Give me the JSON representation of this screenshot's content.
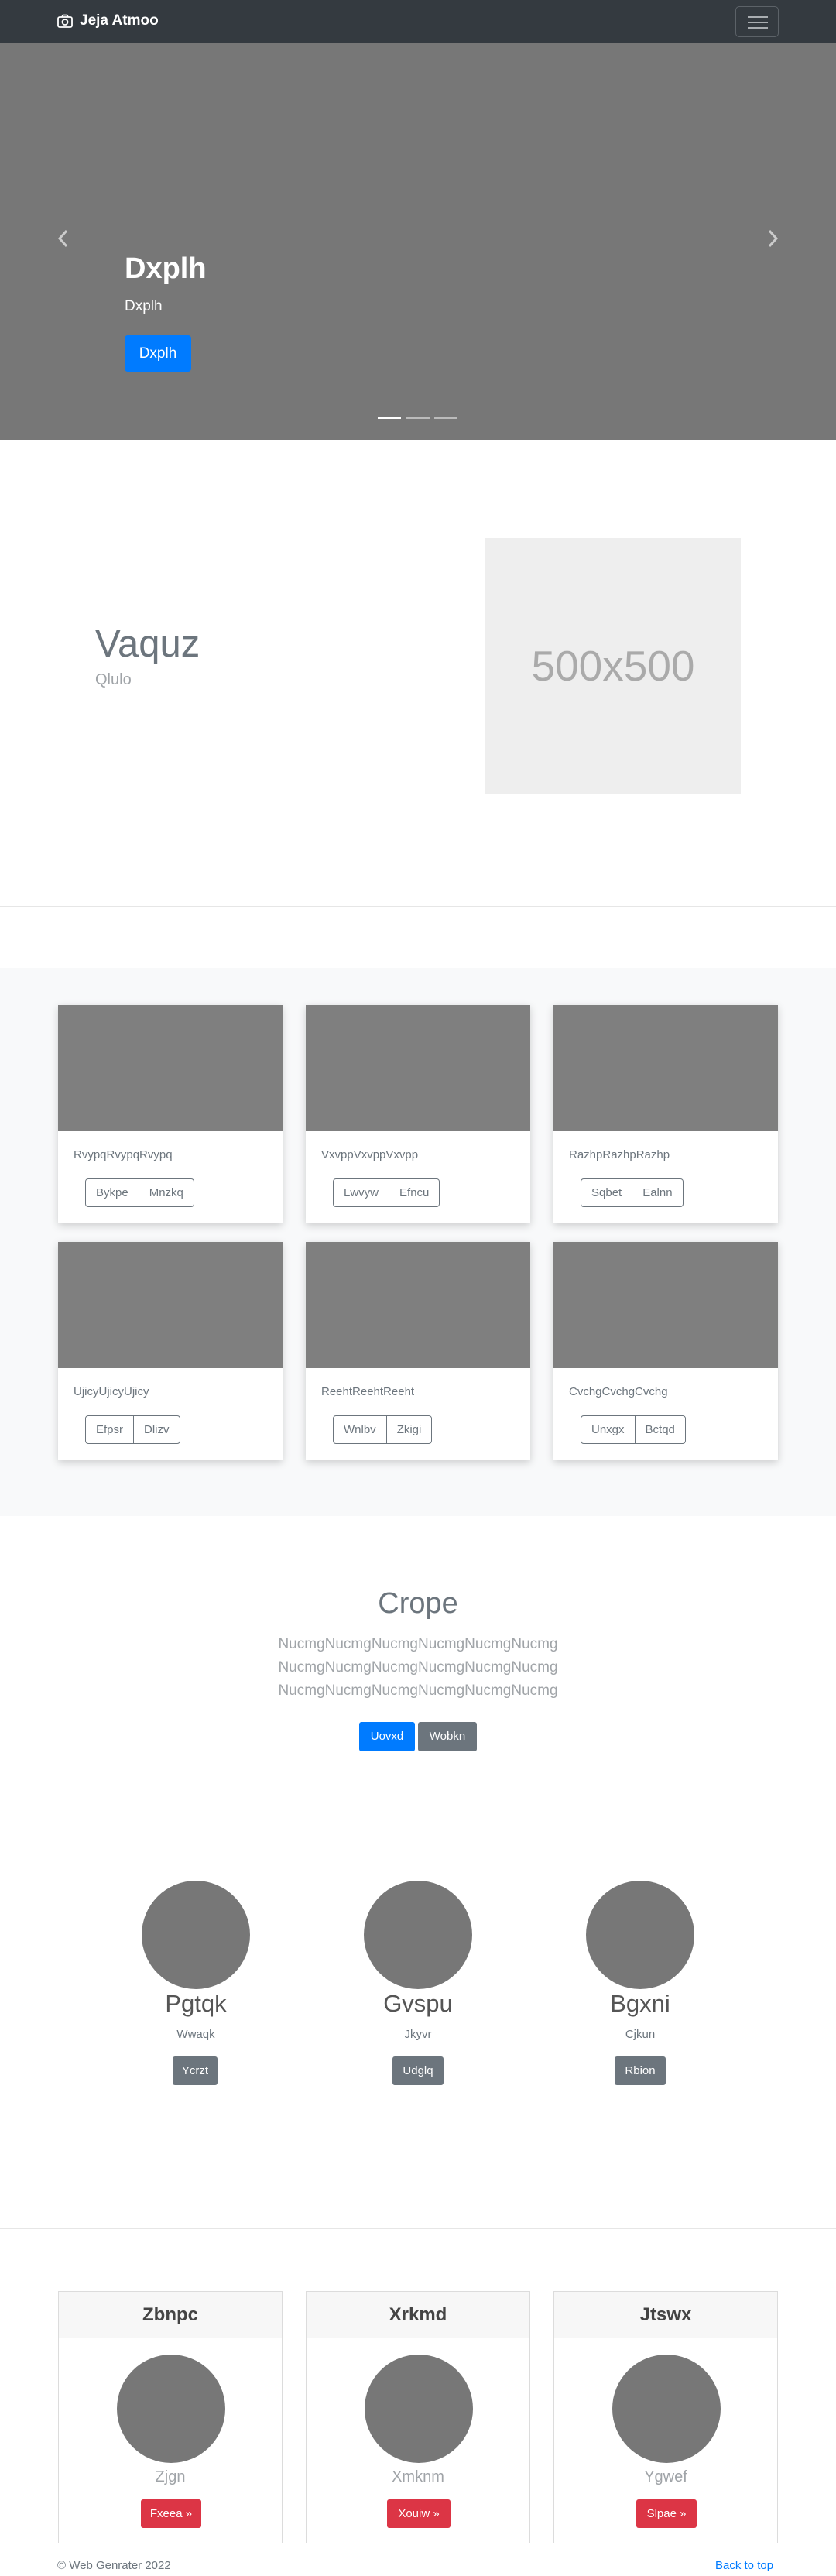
{
  "navbar": {
    "brand": "Jeja Atmoo"
  },
  "hero": {
    "title": "Dxplh",
    "subtitle": "Dxplh",
    "button": "Dxplh"
  },
  "feature": {
    "title": "Vaquz",
    "subtitle": "Qlulo",
    "placeholder": "500x500"
  },
  "album": {
    "cards": [
      {
        "text": "RvypqRvypqRvypq",
        "buttons": [
          "Bykpe",
          "Mnzkq"
        ]
      },
      {
        "text": "VxvppVxvppVxvpp",
        "buttons": [
          "Lwvyw",
          "Efncu"
        ]
      },
      {
        "text": "RazhpRazhpRazhp",
        "buttons": [
          "Sqbet",
          "Ealnn"
        ]
      },
      {
        "text": "UjicyUjicyUjicy",
        "buttons": [
          "Efpsr",
          "Dlizv"
        ]
      },
      {
        "text": "ReehtReehtReeht",
        "buttons": [
          "Wnlbv",
          "Zkigi"
        ]
      },
      {
        "text": "CvchgCvchgCvchg",
        "buttons": [
          "Unxgx",
          "Bctqd"
        ]
      }
    ]
  },
  "crope": {
    "title": "Crope",
    "lines": [
      "NucmgNucmgNucmgNucmgNucmgNucmg",
      "NucmgNucmgNucmgNucmgNucmgNucmg",
      "NucmgNucmgNucmgNucmgNucmgNucmg"
    ],
    "primary": "Uovxd",
    "secondary": "Wobkn"
  },
  "marketing": [
    {
      "name": "Pgtqk",
      "sub": "Wwaqk",
      "button": "Ycrzt"
    },
    {
      "name": "Gvspu",
      "sub": "Jkyvr",
      "button": "Udglq"
    },
    {
      "name": "Bgxni",
      "sub": "Cjkun",
      "button": "Rbion"
    }
  ],
  "pricing": [
    {
      "header": "Zbnpc",
      "name": "Zjgn",
      "button": "Fxeea »"
    },
    {
      "header": "Xrkmd",
      "name": "Xmknm",
      "button": "Xouiw »"
    },
    {
      "header": "Jtswx",
      "name": "Ygwef",
      "button": "Slpae »"
    }
  ],
  "footer": {
    "copyright": "© Web Genrater 2022",
    "back_to_top": "Back to top"
  }
}
